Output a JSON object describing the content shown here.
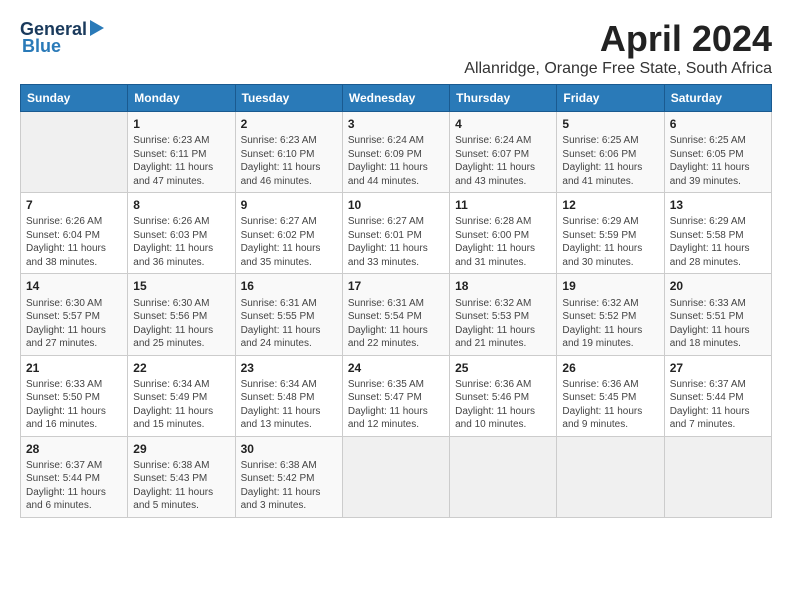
{
  "header": {
    "logo_line1": "General",
    "logo_line2": "Blue",
    "main_title": "April 2024",
    "subtitle": "Allanridge, Orange Free State, South Africa"
  },
  "days_of_week": [
    "Sunday",
    "Monday",
    "Tuesday",
    "Wednesday",
    "Thursday",
    "Friday",
    "Saturday"
  ],
  "weeks": [
    [
      {
        "num": "",
        "info": ""
      },
      {
        "num": "1",
        "info": "Sunrise: 6:23 AM\nSunset: 6:11 PM\nDaylight: 11 hours\nand 47 minutes."
      },
      {
        "num": "2",
        "info": "Sunrise: 6:23 AM\nSunset: 6:10 PM\nDaylight: 11 hours\nand 46 minutes."
      },
      {
        "num": "3",
        "info": "Sunrise: 6:24 AM\nSunset: 6:09 PM\nDaylight: 11 hours\nand 44 minutes."
      },
      {
        "num": "4",
        "info": "Sunrise: 6:24 AM\nSunset: 6:07 PM\nDaylight: 11 hours\nand 43 minutes."
      },
      {
        "num": "5",
        "info": "Sunrise: 6:25 AM\nSunset: 6:06 PM\nDaylight: 11 hours\nand 41 minutes."
      },
      {
        "num": "6",
        "info": "Sunrise: 6:25 AM\nSunset: 6:05 PM\nDaylight: 11 hours\nand 39 minutes."
      }
    ],
    [
      {
        "num": "7",
        "info": "Sunrise: 6:26 AM\nSunset: 6:04 PM\nDaylight: 11 hours\nand 38 minutes."
      },
      {
        "num": "8",
        "info": "Sunrise: 6:26 AM\nSunset: 6:03 PM\nDaylight: 11 hours\nand 36 minutes."
      },
      {
        "num": "9",
        "info": "Sunrise: 6:27 AM\nSunset: 6:02 PM\nDaylight: 11 hours\nand 35 minutes."
      },
      {
        "num": "10",
        "info": "Sunrise: 6:27 AM\nSunset: 6:01 PM\nDaylight: 11 hours\nand 33 minutes."
      },
      {
        "num": "11",
        "info": "Sunrise: 6:28 AM\nSunset: 6:00 PM\nDaylight: 11 hours\nand 31 minutes."
      },
      {
        "num": "12",
        "info": "Sunrise: 6:29 AM\nSunset: 5:59 PM\nDaylight: 11 hours\nand 30 minutes."
      },
      {
        "num": "13",
        "info": "Sunrise: 6:29 AM\nSunset: 5:58 PM\nDaylight: 11 hours\nand 28 minutes."
      }
    ],
    [
      {
        "num": "14",
        "info": "Sunrise: 6:30 AM\nSunset: 5:57 PM\nDaylight: 11 hours\nand 27 minutes."
      },
      {
        "num": "15",
        "info": "Sunrise: 6:30 AM\nSunset: 5:56 PM\nDaylight: 11 hours\nand 25 minutes."
      },
      {
        "num": "16",
        "info": "Sunrise: 6:31 AM\nSunset: 5:55 PM\nDaylight: 11 hours\nand 24 minutes."
      },
      {
        "num": "17",
        "info": "Sunrise: 6:31 AM\nSunset: 5:54 PM\nDaylight: 11 hours\nand 22 minutes."
      },
      {
        "num": "18",
        "info": "Sunrise: 6:32 AM\nSunset: 5:53 PM\nDaylight: 11 hours\nand 21 minutes."
      },
      {
        "num": "19",
        "info": "Sunrise: 6:32 AM\nSunset: 5:52 PM\nDaylight: 11 hours\nand 19 minutes."
      },
      {
        "num": "20",
        "info": "Sunrise: 6:33 AM\nSunset: 5:51 PM\nDaylight: 11 hours\nand 18 minutes."
      }
    ],
    [
      {
        "num": "21",
        "info": "Sunrise: 6:33 AM\nSunset: 5:50 PM\nDaylight: 11 hours\nand 16 minutes."
      },
      {
        "num": "22",
        "info": "Sunrise: 6:34 AM\nSunset: 5:49 PM\nDaylight: 11 hours\nand 15 minutes."
      },
      {
        "num": "23",
        "info": "Sunrise: 6:34 AM\nSunset: 5:48 PM\nDaylight: 11 hours\nand 13 minutes."
      },
      {
        "num": "24",
        "info": "Sunrise: 6:35 AM\nSunset: 5:47 PM\nDaylight: 11 hours\nand 12 minutes."
      },
      {
        "num": "25",
        "info": "Sunrise: 6:36 AM\nSunset: 5:46 PM\nDaylight: 11 hours\nand 10 minutes."
      },
      {
        "num": "26",
        "info": "Sunrise: 6:36 AM\nSunset: 5:45 PM\nDaylight: 11 hours\nand 9 minutes."
      },
      {
        "num": "27",
        "info": "Sunrise: 6:37 AM\nSunset: 5:44 PM\nDaylight: 11 hours\nand 7 minutes."
      }
    ],
    [
      {
        "num": "28",
        "info": "Sunrise: 6:37 AM\nSunset: 5:44 PM\nDaylight: 11 hours\nand 6 minutes."
      },
      {
        "num": "29",
        "info": "Sunrise: 6:38 AM\nSunset: 5:43 PM\nDaylight: 11 hours\nand 5 minutes."
      },
      {
        "num": "30",
        "info": "Sunrise: 6:38 AM\nSunset: 5:42 PM\nDaylight: 11 hours\nand 3 minutes."
      },
      {
        "num": "",
        "info": ""
      },
      {
        "num": "",
        "info": ""
      },
      {
        "num": "",
        "info": ""
      },
      {
        "num": "",
        "info": ""
      }
    ]
  ]
}
